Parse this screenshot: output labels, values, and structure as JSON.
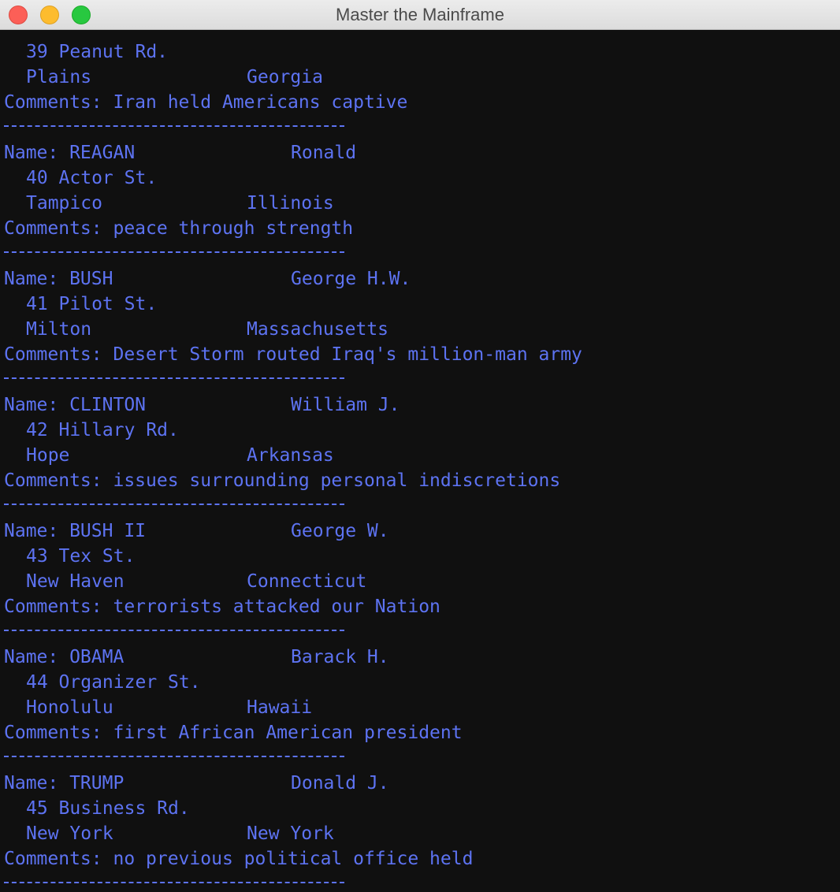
{
  "window": {
    "title": "Master the Mainframe",
    "colors": {
      "background": "#101010",
      "text": "#5d73f2",
      "close": "#fc5f57",
      "minimize": "#fdbc2e",
      "zoom": "#28c840"
    }
  },
  "partial_record": {
    "address": "39 Peanut Rd.",
    "city": "Plains",
    "state": "Georgia",
    "comments": "Comments: Iran held Americans captive"
  },
  "records": [
    {
      "name": "Name: REAGAN",
      "first": "Ronald",
      "address": "40 Actor St.",
      "city": "Tampico",
      "state": "Illinois",
      "comments": "Comments: peace through strength"
    },
    {
      "name": "Name: BUSH",
      "first": "George H.W.",
      "address": "41 Pilot St.",
      "city": "Milton",
      "state": "Massachusetts",
      "comments": "Comments: Desert Storm routed Iraq's million-man army"
    },
    {
      "name": "Name: CLINTON",
      "first": "William J.",
      "address": "42 Hillary Rd.",
      "city": "Hope",
      "state": "Arkansas",
      "comments": "Comments: issues surrounding personal indiscretions"
    },
    {
      "name": "Name: BUSH II",
      "first": "George W.",
      "address": "43 Tex St.",
      "city": "New Haven",
      "state": "Connecticut",
      "comments": "Comments: terrorists attacked our Nation"
    },
    {
      "name": "Name: OBAMA",
      "first": "Barack H.",
      "address": "44 Organizer St.",
      "city": "Honolulu",
      "state": "Hawaii",
      "comments": "Comments: first African American president"
    },
    {
      "name": "Name: TRUMP",
      "first": "Donald J.",
      "address": "45 Business Rd.",
      "city": "New York",
      "state": "New York",
      "comments": "Comments: no previous political office held"
    }
  ]
}
